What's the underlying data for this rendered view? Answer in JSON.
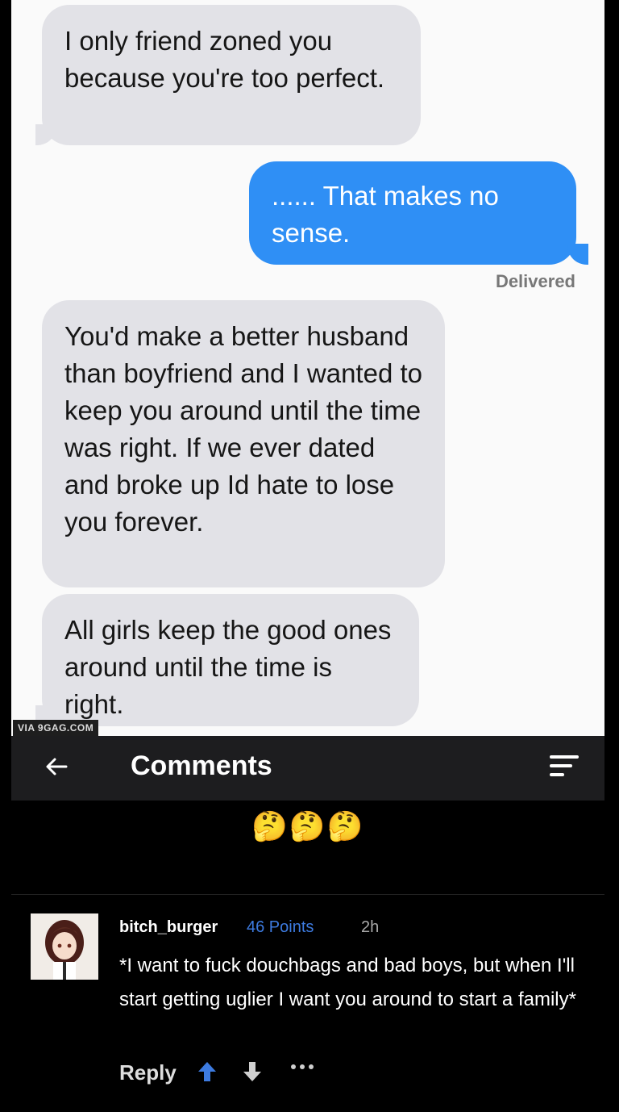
{
  "messages": [
    {
      "side": "received",
      "text": "I only friend zoned you because you're too perfect."
    },
    {
      "side": "sent",
      "text": "...... That makes no sense."
    },
    {
      "side": "received",
      "text": "You'd make a better husband than boyfriend and I wanted to keep you around until the time was right. If we ever dated and broke up Id hate to lose you forever."
    },
    {
      "side": "received",
      "text": "All girls keep the good ones around until the time is right."
    }
  ],
  "delivered_label": "Delivered",
  "watermark": "VIA 9GAG.COM",
  "header": {
    "back_icon": "arrow-left-icon",
    "title": "Comments",
    "sort_icon": "sort-icon"
  },
  "reaction_emojis": "🤔🤔🤔",
  "comment": {
    "username": "bitch_burger",
    "points": "46 Points",
    "time": "2h",
    "text": "*I want to fuck douchbags and bad boys, but when I'll start getting uglier I want you around to start a family*",
    "reply_label": "Reply",
    "upvote_icon": "arrow-up-icon",
    "downvote_icon": "arrow-down-icon",
    "more_icon": "more-dots-icon"
  },
  "colors": {
    "sent_bubble": "#2f8ff5",
    "received_bubble": "#e2e2e7",
    "points": "#3d7be0",
    "background": "#000000"
  }
}
